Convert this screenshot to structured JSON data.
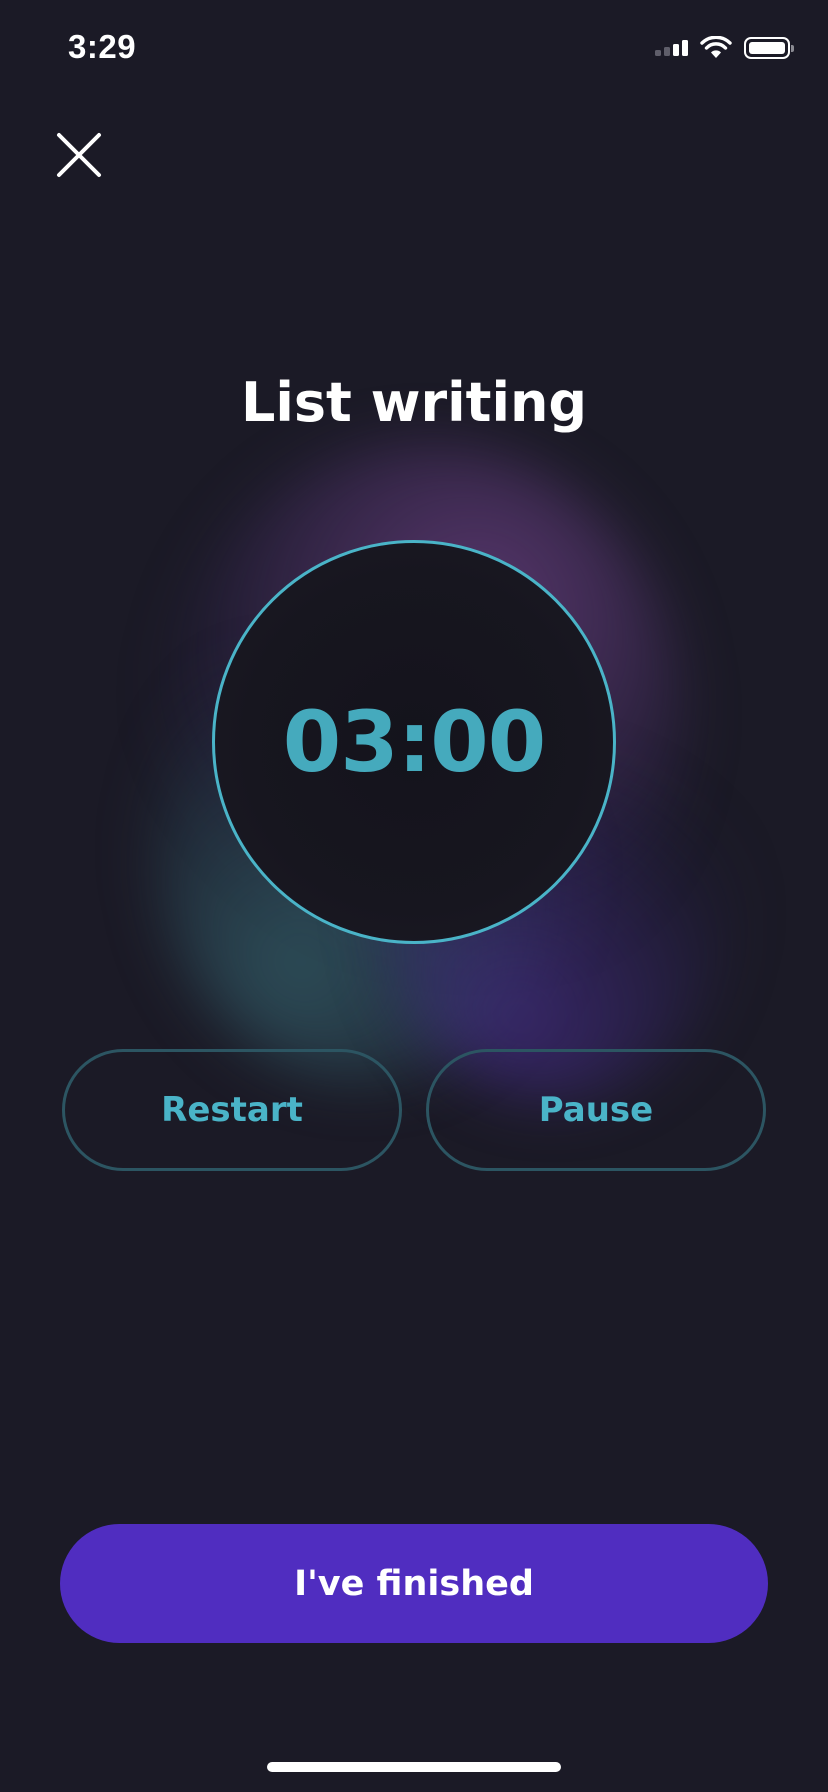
{
  "status_bar": {
    "time": "3:29",
    "icons": [
      "cellular-signal-icon",
      "wifi-icon",
      "battery-icon"
    ]
  },
  "header": {
    "close_icon": "close-icon"
  },
  "exercise": {
    "title": "List writing"
  },
  "timer": {
    "display": "03:00",
    "ring_color": "#4ab4c8"
  },
  "controls": {
    "restart_label": "Restart",
    "pause_label": "Pause"
  },
  "footer": {
    "finish_label": "I've finished"
  },
  "colors": {
    "background": "#1b1a26",
    "accent": "#4ab4c8",
    "primary_button": "#502dc0",
    "text": "#ffffff"
  }
}
